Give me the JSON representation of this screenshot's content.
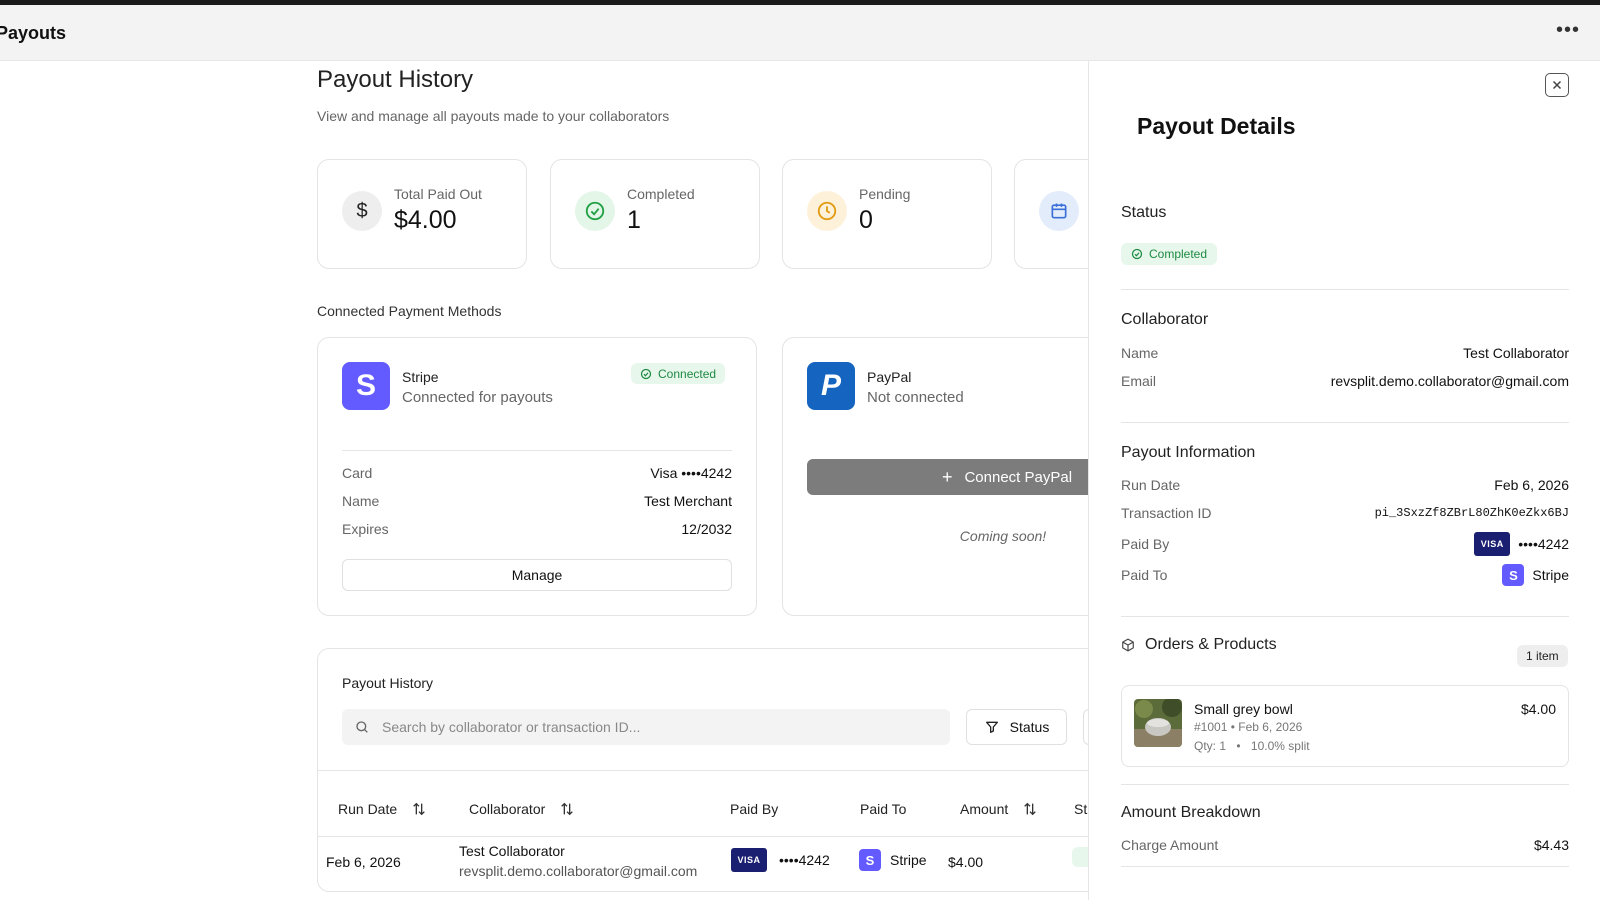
{
  "app": {
    "title": "Payouts",
    "more_icon": "ellipsis-icon"
  },
  "header": {
    "title": "Payout History",
    "subtitle": "View and manage all payouts made to your collaborators"
  },
  "stats": [
    {
      "label": "Total Paid Out",
      "value": "$4.00",
      "icon": "dollar-icon"
    },
    {
      "label": "Completed",
      "value": "1",
      "icon": "check-circle-icon"
    },
    {
      "label": "Pending",
      "value": "0",
      "icon": "clock-icon"
    },
    {
      "label": "",
      "value": "",
      "icon": "calendar-icon"
    }
  ],
  "payment_methods": {
    "section_label": "Connected Payment Methods",
    "stripe": {
      "name": "Stripe",
      "status": "Connected for payouts",
      "badge": "Connected",
      "logo_letter": "S",
      "details": [
        {
          "label": "Card",
          "value": "Visa ••••4242"
        },
        {
          "label": "Name",
          "value": "Test Merchant"
        },
        {
          "label": "Expires",
          "value": "12/2032"
        }
      ],
      "manage_label": "Manage"
    },
    "paypal": {
      "name": "PayPal",
      "status": "Not connected",
      "logo_letter": "P",
      "connect_label": "Connect PayPal",
      "note": "Coming soon!"
    }
  },
  "history": {
    "title": "Payout History",
    "search_placeholder": "Search by collaborator or transaction ID...",
    "status_filter_label": "Status",
    "columns": {
      "run_date": "Run Date",
      "collaborator": "Collaborator",
      "paid_by": "Paid By",
      "paid_to": "Paid To",
      "amount": "Amount",
      "status": "St"
    },
    "rows": [
      {
        "run_date": "Feb 6, 2026",
        "collaborator_name": "Test Collaborator",
        "collaborator_email": "revsplit.demo.collaborator@gmail.com",
        "card_brand": "VISA",
        "card_last4": "••••4242",
        "paid_to_letter": "S",
        "paid_to": "Stripe",
        "amount": "$4.00"
      }
    ]
  },
  "details_panel": {
    "title": "Payout Details",
    "status_heading": "Status",
    "status_badge": "Completed",
    "collaborator_heading": "Collaborator",
    "collaborator": [
      {
        "label": "Name",
        "value": "Test Collaborator"
      },
      {
        "label": "Email",
        "value": "revsplit.demo.collaborator@gmail.com"
      }
    ],
    "payout_info_heading": "Payout Information",
    "payout_info": {
      "run_date_label": "Run Date",
      "run_date": "Feb 6, 2026",
      "transaction_label": "Transaction ID",
      "transaction_id": "pi_3SxzZf8ZBrL80ZhK0eZkx6BJ",
      "paid_by_label": "Paid By",
      "paid_by_brand": "VISA",
      "paid_by_last4": "••••4242",
      "paid_to_label": "Paid To",
      "paid_to_letter": "S",
      "paid_to": "Stripe"
    },
    "orders_heading": "Orders & Products",
    "orders_count": "1 item",
    "orders": [
      {
        "name": "Small grey bowl",
        "meta": "#1001 • Feb 6, 2026",
        "qty": "Qty: 1",
        "split": "10.0% split",
        "price": "$4.00"
      }
    ],
    "breakdown_heading": "Amount Breakdown",
    "breakdown": [
      {
        "label": "Charge Amount",
        "value": "$4.43"
      }
    ]
  },
  "colors": {
    "accent_green": "#1f8a43",
    "stripe_purple": "#635bff",
    "paypal_blue": "#1565c0",
    "visa_navy": "#1a1f71"
  }
}
